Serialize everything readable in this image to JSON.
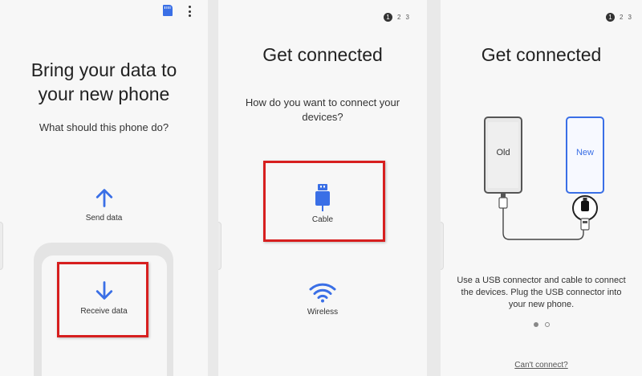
{
  "screen1": {
    "menu_icon": "more-vert-icon",
    "sd_icon": "sd-card-icon",
    "title_line1": "Bring your data to",
    "title_line2": "your new phone",
    "subtitle": "What should this phone do?",
    "send_label": "Send data",
    "receive_label": "Receive data"
  },
  "screen2": {
    "pager": [
      "1",
      "2",
      "3"
    ],
    "title": "Get connected",
    "question_line1": "How do you want to connect your",
    "question_line2": "devices?",
    "cable_label": "Cable",
    "wireless_label": "Wireless"
  },
  "screen3": {
    "pager": [
      "1",
      "2",
      "3"
    ],
    "title": "Get connected",
    "old_label": "Old",
    "new_label": "New",
    "desc_line1": "Use a USB connector and cable to connect",
    "desc_line2": "the devices. Plug the USB connector into",
    "desc_line3": "your new phone.",
    "cant_connect": "Can't connect?"
  },
  "colors": {
    "accent": "#3a6fe6",
    "highlight": "#d71f1f"
  }
}
